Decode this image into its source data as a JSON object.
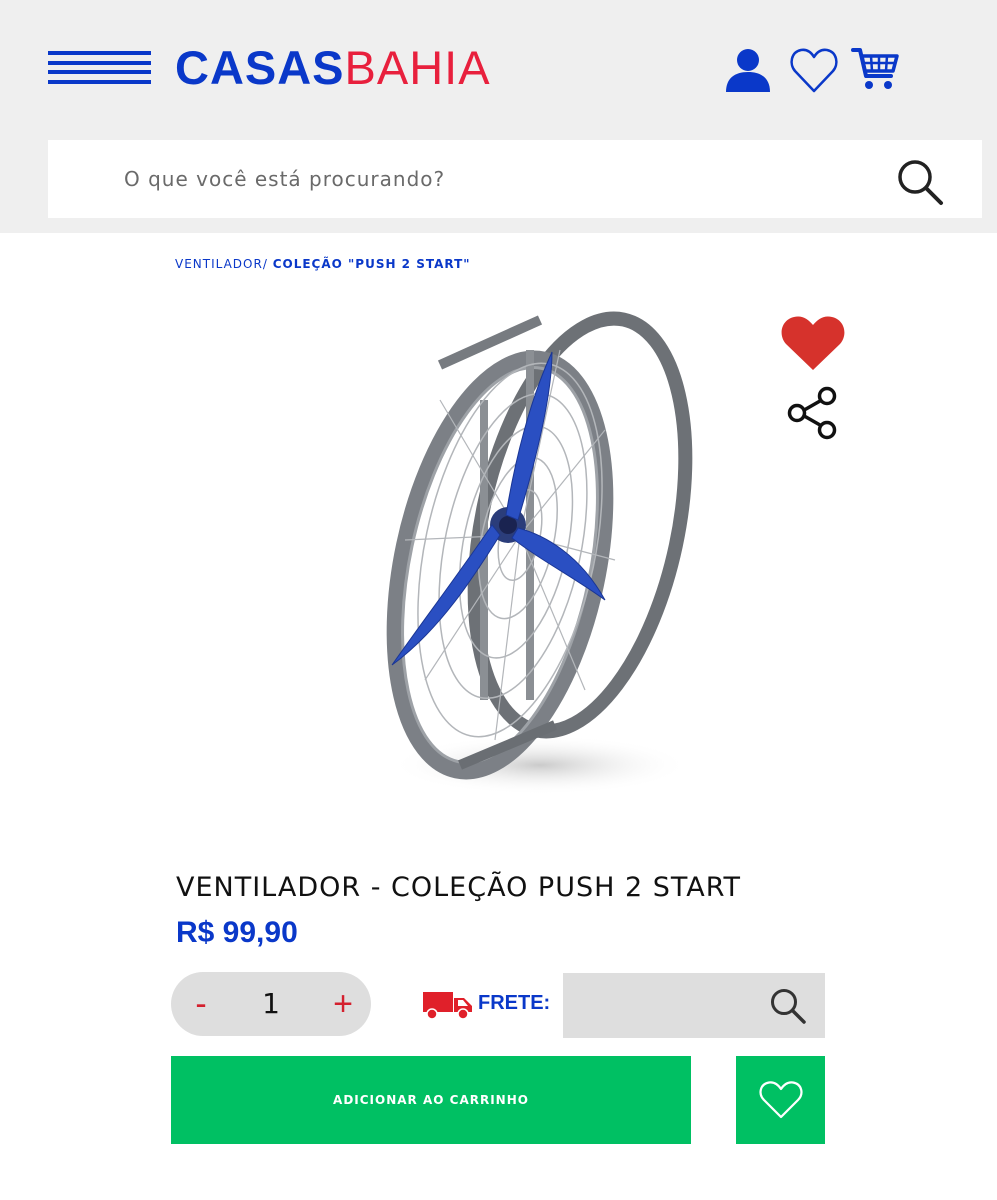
{
  "header": {
    "logo_part1": "CASAS",
    "logo_part2": "BAHIA",
    "menu_icon": "hamburger-menu-icon",
    "account_icon": "user-icon",
    "wishlist_icon": "heart-outline-icon",
    "cart_icon": "cart-icon",
    "brand_blue": "#0a38c9",
    "brand_red": "#e8203d"
  },
  "search": {
    "placeholder": "O que você está procurando?",
    "icon": "search-icon"
  },
  "breadcrumb": {
    "parent": "VENTILADOR/",
    "current": "COLEÇÃO \"PUSH 2 START\""
  },
  "product": {
    "title": "VENTILADOR - COLEÇÃO PUSH 2 START",
    "price": "R$ 99,90",
    "image_icon": "industrial-fan-image",
    "favorite_icon": "heart-filled-icon",
    "share_icon": "share-icon"
  },
  "quantity": {
    "minus": "-",
    "value": "1",
    "plus": "+"
  },
  "shipping": {
    "label": "FRETE:",
    "icon": "truck-icon",
    "cep_value": ""
  },
  "actions": {
    "add_to_cart": "ADICIONAR AO CARRINHO",
    "wishlist_icon": "heart-outline-icon",
    "accent_green": "#00c063"
  }
}
